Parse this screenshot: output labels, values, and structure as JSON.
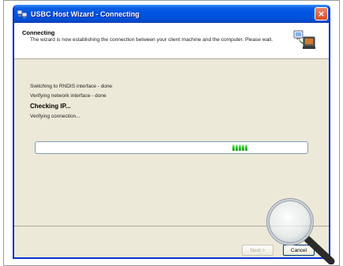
{
  "window": {
    "title": "USBC Host Wizard - Connecting",
    "close_label": "×"
  },
  "header": {
    "title": "Connecting",
    "description": "The wizard is now establishing the connection between your client machine and the computer. Please wait."
  },
  "status_lines": [
    "Switching to RNDIS interface - done",
    "Verifying network interface - done",
    "Checking IP...",
    "Verifying connection..."
  ],
  "progress": {
    "fraction": 0.15,
    "block_count": 5,
    "fill_color": "#28c628"
  },
  "buttons": {
    "next_label": "Next >",
    "cancel_label": "Cancel"
  },
  "icons": {
    "title_icon": "network-computers-icon",
    "header_icon": "connected-computers-icon",
    "magnifier": "magnifier-icon"
  },
  "colors": {
    "titlebar": "#0054e3",
    "window_bg": "#ece9d8",
    "close": "#d54c25"
  }
}
